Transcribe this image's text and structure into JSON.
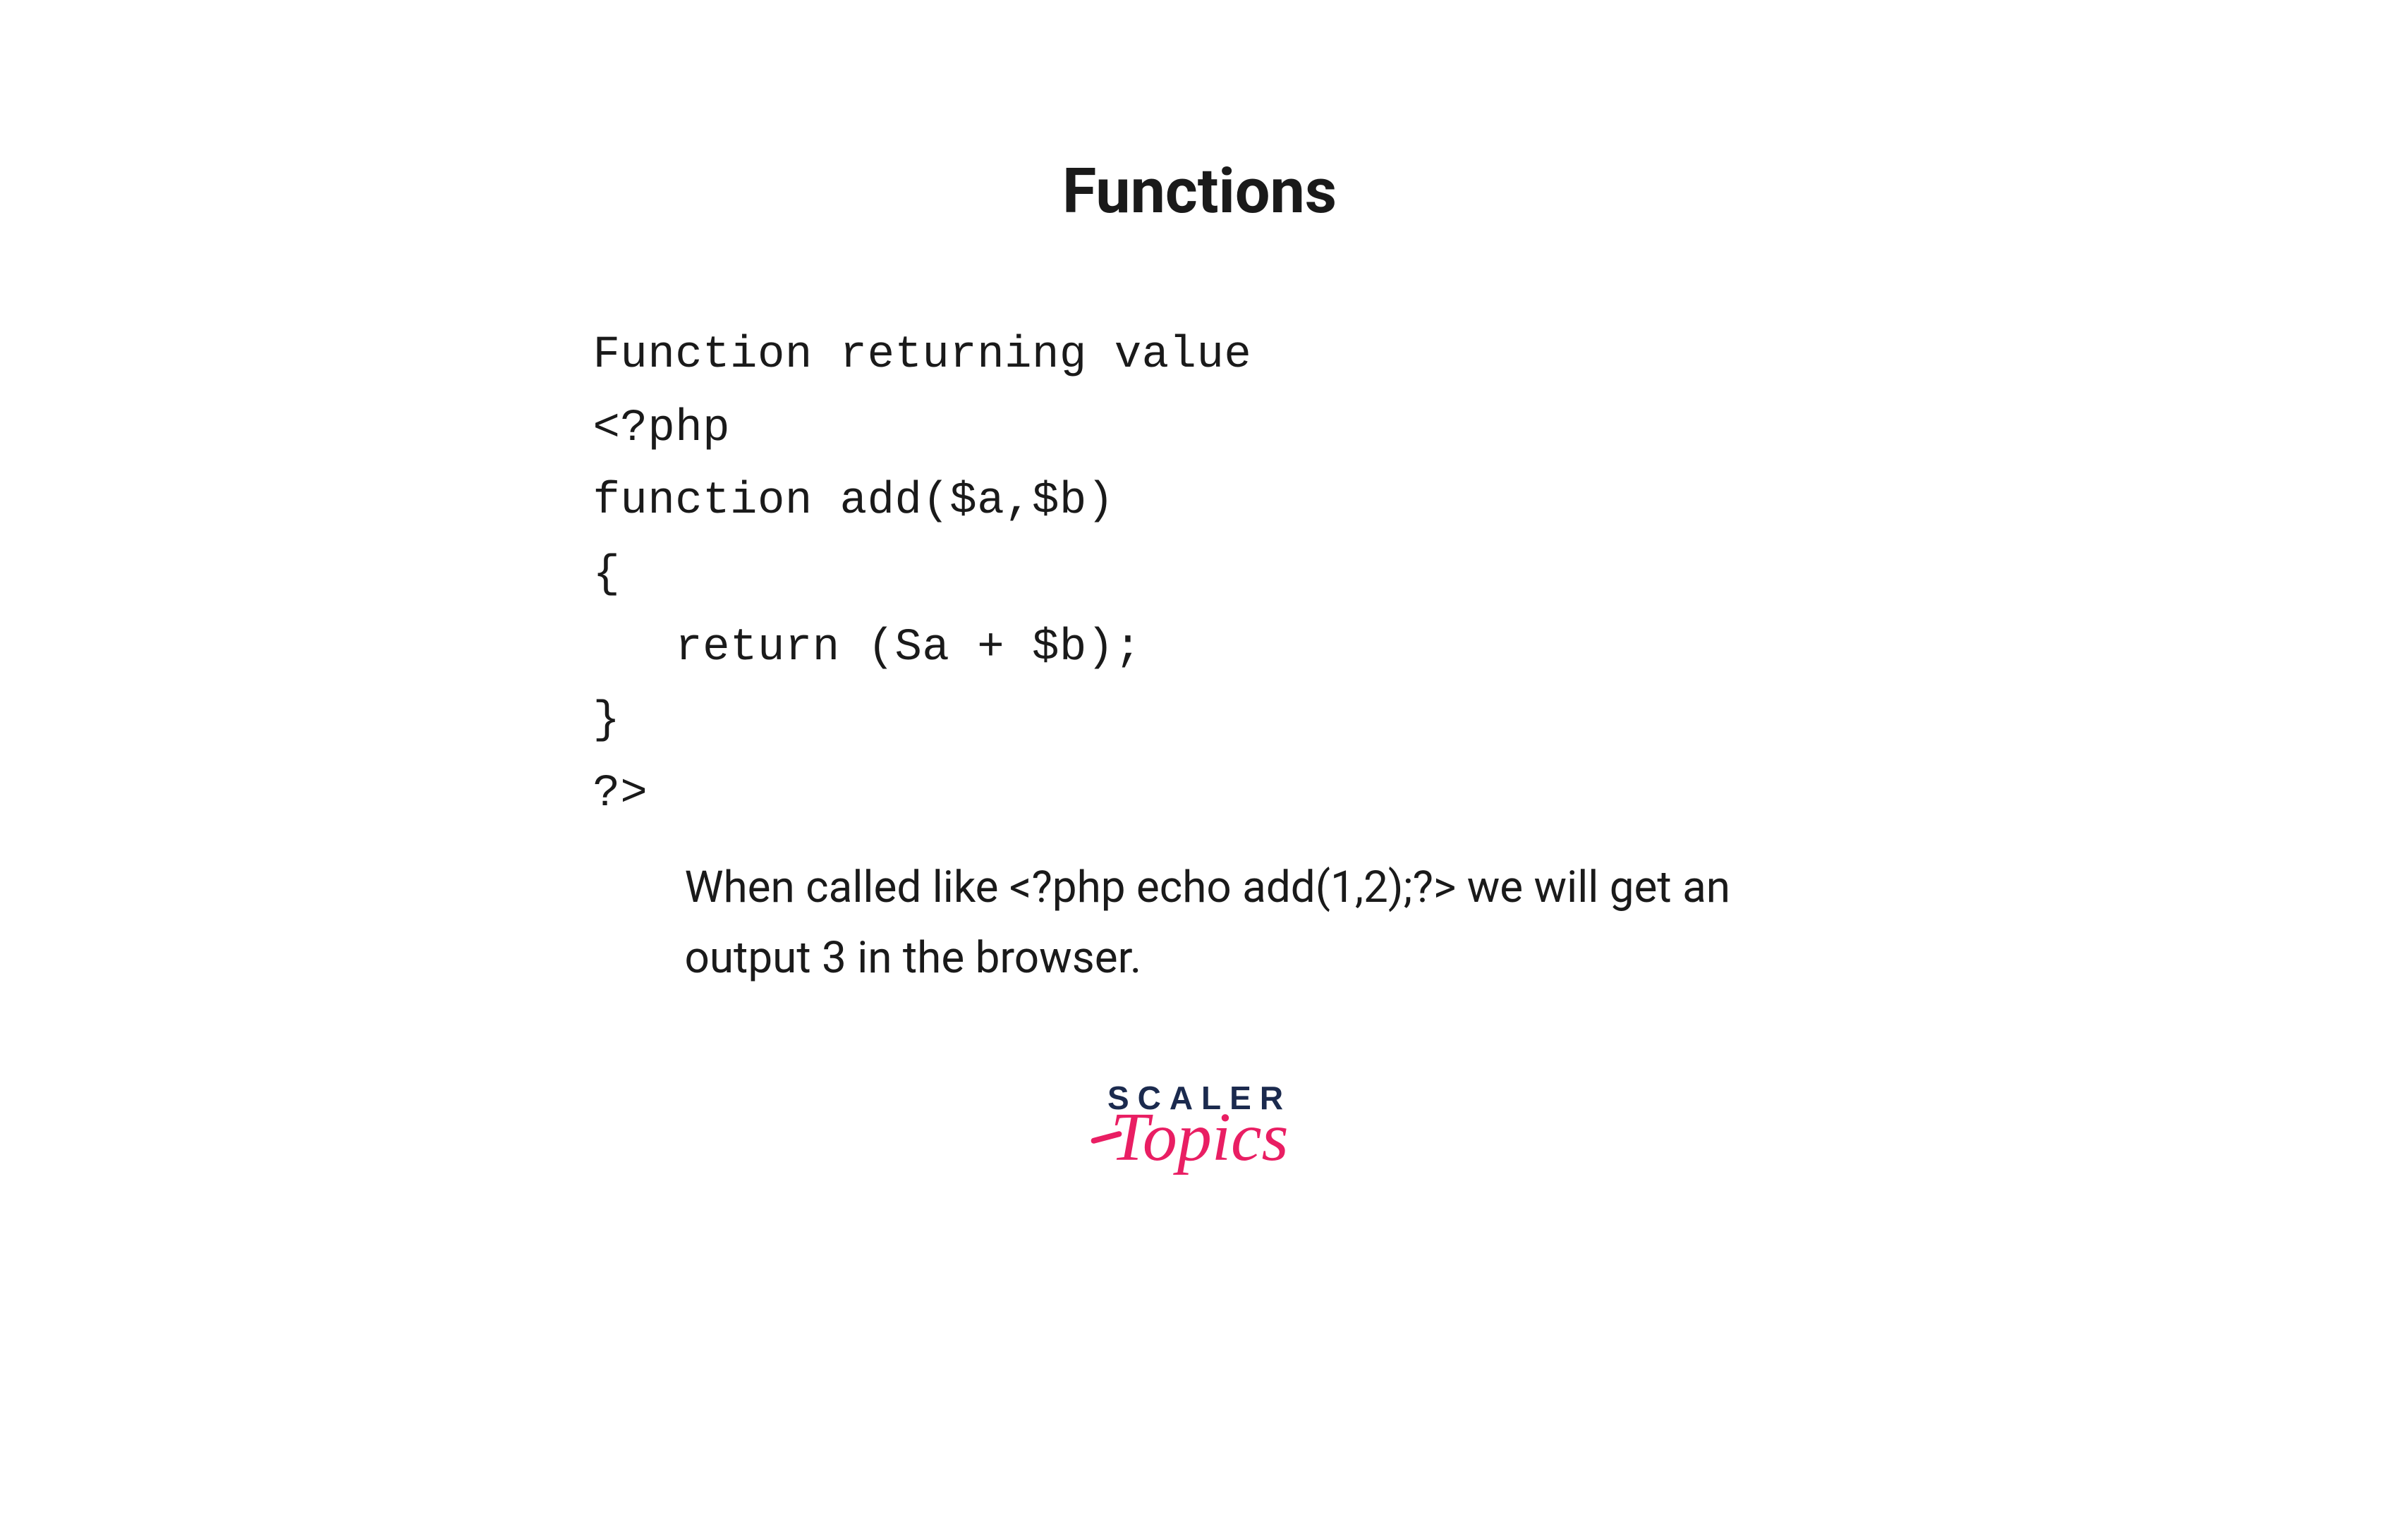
{
  "title": "Functions",
  "code": {
    "line1": "Function returning value",
    "line2": "<?php",
    "line3": "function add($a,$b)",
    "line4": "{",
    "line5": "   return (Sa + $b);",
    "line6": "}",
    "line7": "?>"
  },
  "explanation": "When called like <?php echo add(1,2);?> we will get an output 3 in the browser.",
  "logo": {
    "brand": "SCALER",
    "product": "Topics"
  }
}
